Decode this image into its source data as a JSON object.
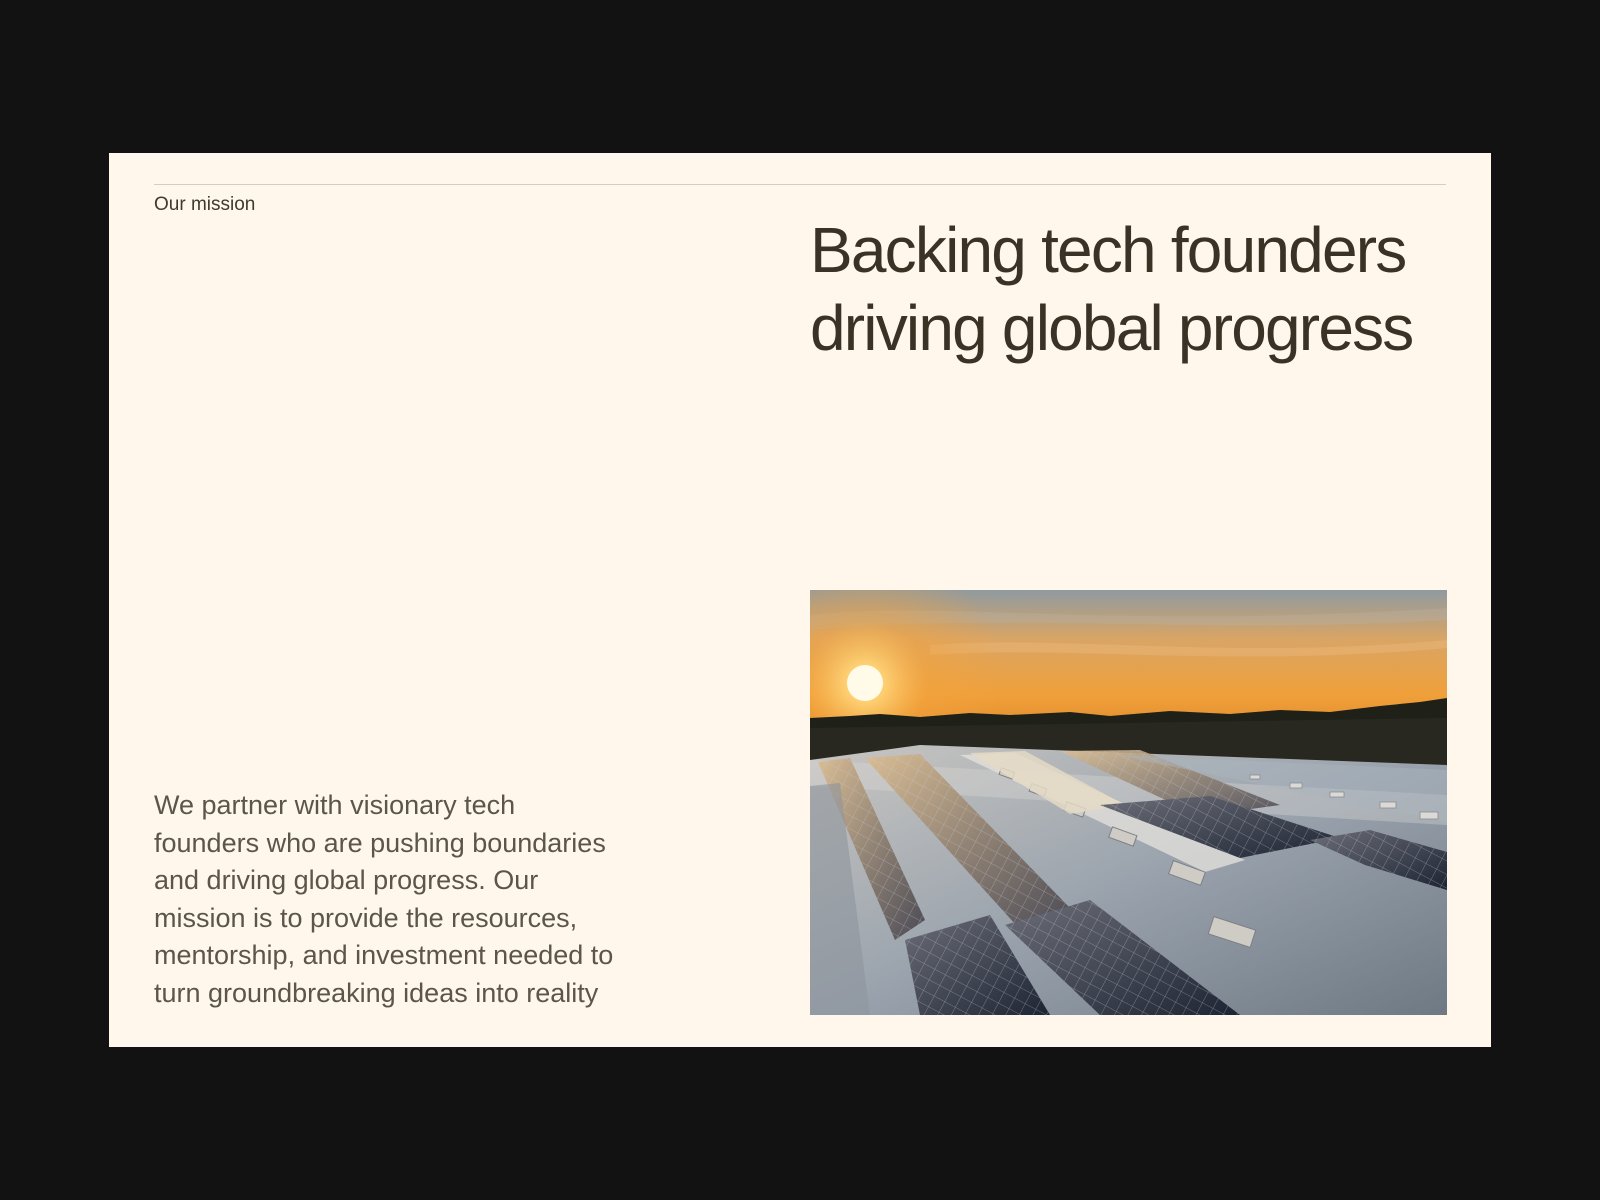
{
  "section": {
    "eyebrow": "Our mission",
    "headline": {
      "line1": "Backing tech founders",
      "line2": "driving global progress"
    },
    "body": {
      "line1": "We partner with visionary tech",
      "line2": "founders who are pushing boundaries",
      "line3": "and driving global progress. Our",
      "line4": "mission is to provide the resources,",
      "line5": "mentorship, and investment needed to",
      "line6": "turn groundbreaking ideas into reality"
    }
  },
  "colors": {
    "page_background": "#121212",
    "card_background": "#fff7eb",
    "headline_text": "#3a3325",
    "body_text": "#5b554a"
  }
}
